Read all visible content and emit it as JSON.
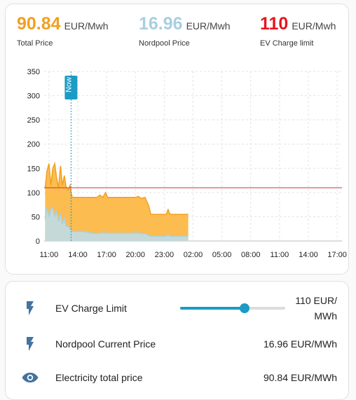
{
  "stats": [
    {
      "value": "90.84",
      "unit": "EUR/Mwh",
      "name": "Total Price",
      "color": "#f2a020"
    },
    {
      "value": "16.96",
      "unit": "EUR/Mwh",
      "name": "Nordpool Price",
      "color": "#a9cfe0"
    },
    {
      "value": "110",
      "unit": "EUR/Mwh",
      "name": "EV Charge limit",
      "color": "#e8141f"
    }
  ],
  "chart_data": {
    "type": "area",
    "x_ticks": [
      "11:00",
      "14:00",
      "17:00",
      "20:00",
      "23:00",
      "02:00",
      "05:00",
      "08:00",
      "11:00",
      "14:00",
      "17:00"
    ],
    "x_range_hours": [
      10.5,
      41.5
    ],
    "y_ticks": [
      0,
      50,
      100,
      150,
      200,
      250,
      300,
      350
    ],
    "ylim": [
      0,
      350
    ],
    "now_hour": 13.3,
    "now_label": "Now",
    "limit_value": 110,
    "series": [
      {
        "name": "Total Price",
        "color": "#f2a020",
        "fill": "#fcbc4f",
        "points": [
          [
            10.6,
            110
          ],
          [
            10.8,
            145
          ],
          [
            11.0,
            160
          ],
          [
            11.2,
            115
          ],
          [
            11.4,
            150
          ],
          [
            11.6,
            160
          ],
          [
            11.8,
            130
          ],
          [
            12.0,
            110
          ],
          [
            12.2,
            155
          ],
          [
            12.4,
            115
          ],
          [
            12.6,
            135
          ],
          [
            12.8,
            110
          ],
          [
            13.0,
            105
          ],
          [
            13.2,
            115
          ],
          [
            13.4,
            90
          ],
          [
            16.0,
            90
          ],
          [
            16.3,
            95
          ],
          [
            16.6,
            90
          ],
          [
            16.9,
            100
          ],
          [
            17.1,
            90
          ],
          [
            20.0,
            90
          ],
          [
            20.3,
            92
          ],
          [
            20.6,
            88
          ],
          [
            21.0,
            90
          ],
          [
            21.4,
            72
          ],
          [
            21.6,
            55
          ],
          [
            23.2,
            55
          ],
          [
            23.4,
            65
          ],
          [
            23.6,
            55
          ],
          [
            25.5,
            55
          ]
        ]
      },
      {
        "name": "Nordpool Price",
        "color": "#a9cfe0",
        "fill": "#c5d9d8",
        "points": [
          [
            10.6,
            45
          ],
          [
            10.8,
            70
          ],
          [
            11.0,
            50
          ],
          [
            11.2,
            65
          ],
          [
            11.4,
            70
          ],
          [
            11.6,
            50
          ],
          [
            11.8,
            62
          ],
          [
            12.0,
            40
          ],
          [
            12.2,
            58
          ],
          [
            12.4,
            35
          ],
          [
            12.6,
            48
          ],
          [
            12.8,
            30
          ],
          [
            13.0,
            30
          ],
          [
            13.4,
            20
          ],
          [
            14.5,
            20
          ],
          [
            15.0,
            18
          ],
          [
            16.0,
            15
          ],
          [
            16.5,
            17
          ],
          [
            17.1,
            16
          ],
          [
            19.5,
            16
          ],
          [
            20.0,
            17
          ],
          [
            21.0,
            15
          ],
          [
            21.6,
            10
          ],
          [
            23.2,
            10
          ],
          [
            23.4,
            13
          ],
          [
            23.6,
            10
          ],
          [
            25.5,
            10
          ]
        ]
      }
    ]
  },
  "entities": [
    {
      "icon": "flash-icon",
      "name": "EV Charge Limit",
      "state_line1": "110 EUR/",
      "state_line2": "MWh",
      "slider_value": 110,
      "slider_min": 0,
      "slider_max": 180
    },
    {
      "icon": "flash-icon",
      "name": "Nordpool Current Price",
      "state": "16.96 EUR/MWh"
    },
    {
      "icon": "eye-icon",
      "name": "Electricity total price",
      "state": "90.84 EUR/MWh"
    }
  ],
  "colors": {
    "accent": "#1c9bc5",
    "icon": "#44739e",
    "limit_line": "#d32f2f",
    "now_line": "#1c9bc5"
  }
}
